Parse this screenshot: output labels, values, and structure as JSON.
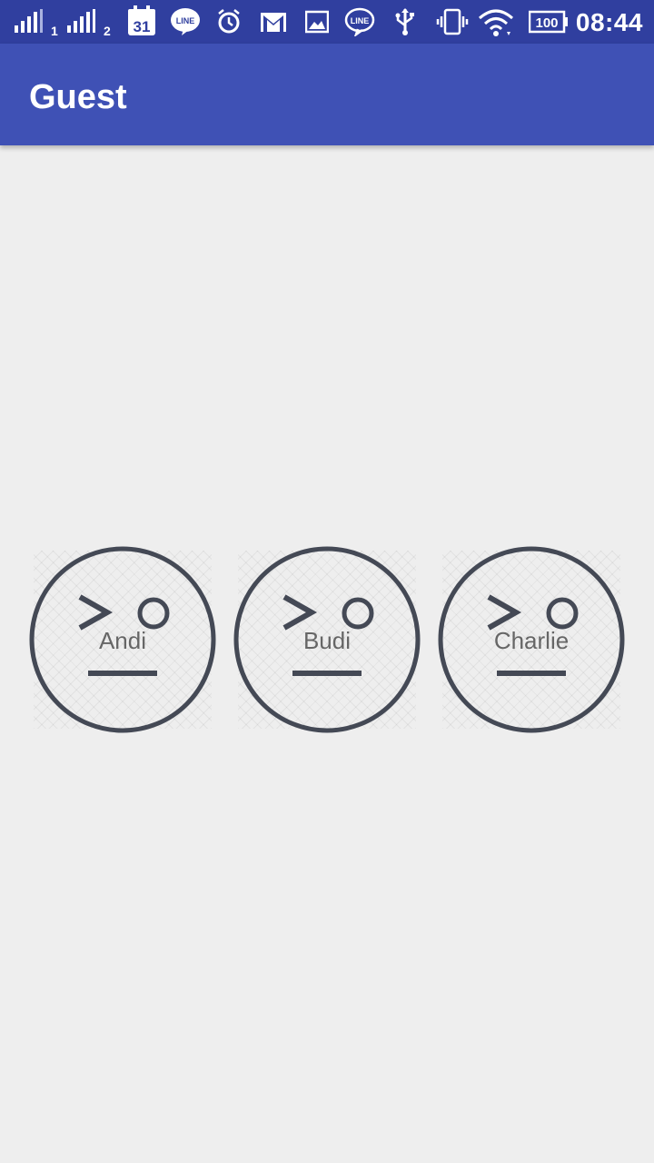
{
  "status_bar": {
    "time": "08:44",
    "battery": "100",
    "sim1": "1",
    "sim2": "2",
    "calendar_day": "31",
    "icons": [
      "signal-icon",
      "calendar-icon",
      "line-icon",
      "alarm-icon",
      "gmail-icon",
      "image-icon",
      "line-icon",
      "usb-icon",
      "vibrate-icon",
      "wifi-icon",
      "battery-icon"
    ]
  },
  "app_bar": {
    "title": "Guest"
  },
  "guests": [
    {
      "name": "Andi"
    },
    {
      "name": "Budi"
    },
    {
      "name": "Charlie"
    }
  ],
  "colors": {
    "primary": "#3f51b5",
    "primary_dark": "#303f9f",
    "avatar_stroke": "#444955",
    "background": "#eeeeee"
  }
}
